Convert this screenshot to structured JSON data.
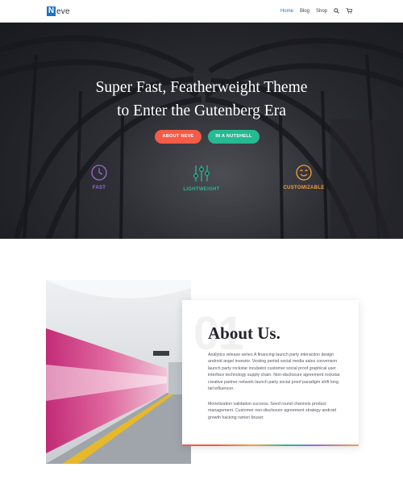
{
  "header": {
    "logo_letter": "N",
    "logo_text": "eve",
    "nav": [
      {
        "label": "Home"
      },
      {
        "label": "Blog"
      },
      {
        "label": "Shop"
      }
    ],
    "icons": [
      "search-icon",
      "cart-icon"
    ],
    "accent_color": "#1a73c9"
  },
  "hero": {
    "title_line1": "Super Fast, Featherweight Theme",
    "title_line2": "to Enter the Gutenberg Era",
    "buttons": {
      "about": "ABOUT NEVE",
      "nutshell": "IN A NUTSHELL"
    },
    "button_colors": {
      "about": "#f25c48",
      "nutshell": "#27b894"
    },
    "features": [
      {
        "label": "FAST",
        "icon": "clock-icon",
        "color": "#9b6cd6"
      },
      {
        "label": "LIGHTWEIGHT",
        "icon": "sliders-icon",
        "color": "#27b894"
      },
      {
        "label": "CUSTOMIZABLE",
        "icon": "smiley-icon",
        "color": "#f3a03b"
      }
    ]
  },
  "about": {
    "number": "01",
    "title": "About Us.",
    "paragraph1": "Analytics release series A financing launch party interaction design android angel investor. Vesting period social media sales conversion launch party rockstar incubator customer social proof graphical user interface technology supply chain. Non-disclosure agreement rockstar creative partner network launch party social proof paradigm shift long tail influencer.",
    "paragraph2": "Monetization validation success. Seed round channels product management. Customer non-disclosure agreement strategy android growth hacking ramen bruser."
  }
}
